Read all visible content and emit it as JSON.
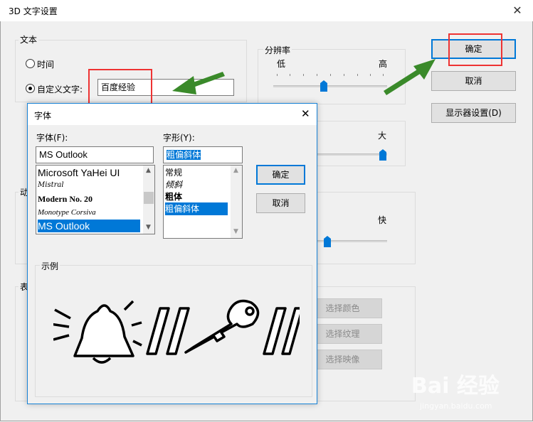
{
  "window": {
    "title": "3D 文字设置"
  },
  "text_group": {
    "label": "文本",
    "radio_time": "时间",
    "radio_custom": "自定义文字:",
    "custom_value": "百度经验"
  },
  "resolution": {
    "label": "分辨率",
    "low": "低",
    "high": "高",
    "level": 0.5
  },
  "size_group": {
    "big_label": "大",
    "level": 1.0
  },
  "motion_group": {
    "label": "动",
    "fast_label": "快",
    "level": 0.35
  },
  "surface_group": {
    "label": "表",
    "btn_color": "选择颜色",
    "btn_texture": "选择纹理",
    "btn_reflect": "选择映像"
  },
  "buttons": {
    "ok": "确定",
    "cancel": "取消",
    "display": "显示器设置(D)"
  },
  "font_dialog": {
    "title": "字体",
    "font_label": "字体(F):",
    "font_value": "MS Outlook",
    "font_items": [
      "Microsoft YaHei UI",
      "Mistral",
      "Modern No. 20",
      "Monotype Corsiva",
      "MS Outlook"
    ],
    "style_label": "字形(Y):",
    "style_value": "粗偏斜体",
    "style_items": [
      "常规",
      "倾斜",
      "粗体",
      "粗偏斜体"
    ],
    "ok": "确定",
    "cancel": "取消",
    "sample_label": "示例"
  },
  "watermark": {
    "brand": "Bai 经验",
    "url": "jingyan.baidu.com"
  },
  "colors": {
    "accent": "#0078d7",
    "highlight_red": "#e33333",
    "arrow_green": "#3a8a2a"
  }
}
